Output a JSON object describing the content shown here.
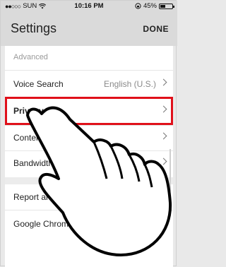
{
  "status_bar": {
    "carrier": "SUN",
    "time": "10:16 PM",
    "battery_percent": "45%",
    "battery_level": 0.45,
    "icons": [
      "signal-dots-icon",
      "wifi-icon",
      "lock-rotation-icon",
      "battery-icon"
    ]
  },
  "header": {
    "title": "Settings",
    "done_label": "DONE"
  },
  "sections": {
    "advanced_header": "Advanced",
    "voice_search": {
      "label": "Voice Search",
      "value": "English (U.S.)"
    },
    "privacy": {
      "label": "Privacy"
    },
    "content_settings": {
      "label": "Content Settings"
    },
    "bandwidth": {
      "label": "Bandwidth"
    },
    "report_issue": {
      "label": "Report an Issue"
    },
    "google_chrome": {
      "label": "Google Chrome"
    }
  },
  "colors": {
    "highlight": "#e0101a",
    "header_bg": "#dadada"
  }
}
